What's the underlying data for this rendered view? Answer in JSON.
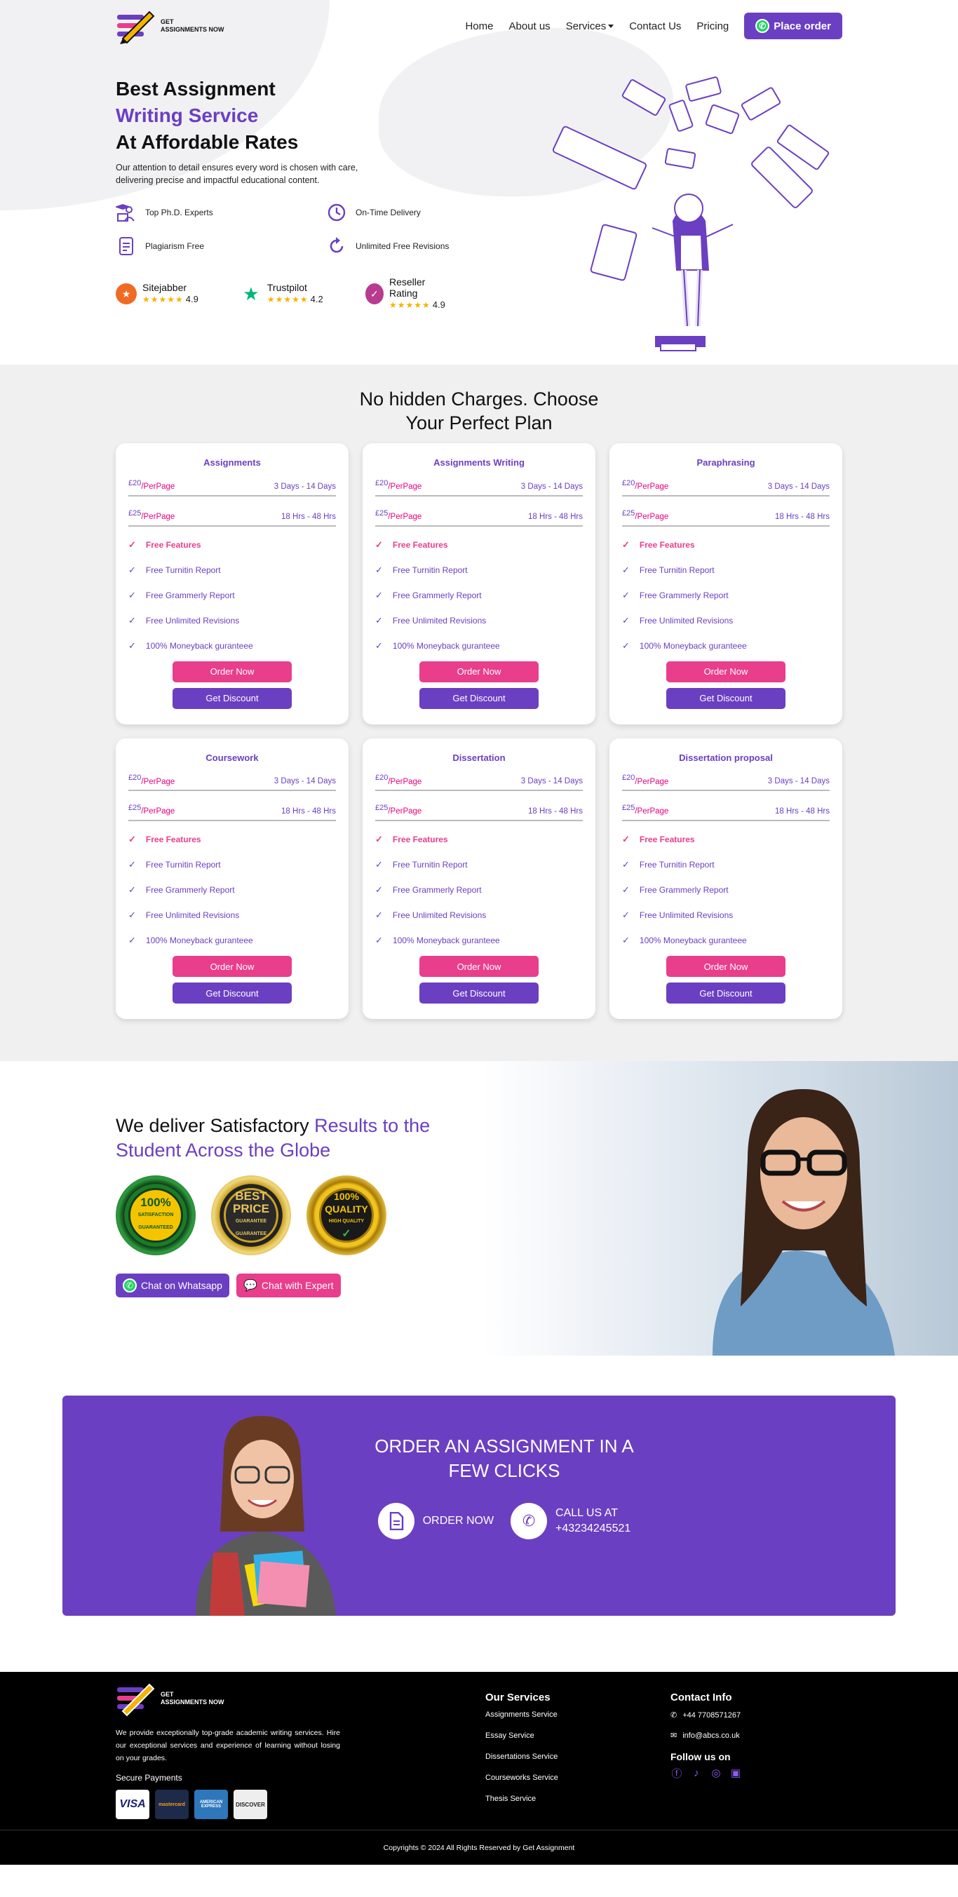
{
  "brand": {
    "line1": "GET",
    "line2": "ASSIGNMENTS NOW"
  },
  "nav": {
    "items": [
      "Home",
      "About us",
      "Services",
      "Contact Us",
      "Pricing"
    ],
    "place_order": "Place order"
  },
  "hero": {
    "title_line1": "Best Assignment",
    "title_line2": "Writing Service",
    "title_line3": "At Affordable Rates",
    "subtitle": "Our attention to detail ensures every word is chosen with care, delivering precise and impactful educational content.",
    "features": [
      {
        "label": "Top Ph.D. Experts",
        "icon": "graduate-icon"
      },
      {
        "label": "On-Time Delivery",
        "icon": "clock-icon"
      },
      {
        "label": "Plagiarism Free",
        "icon": "document-icon"
      },
      {
        "label": "Unlimited Free Revisions",
        "icon": "refresh-icon"
      }
    ],
    "ratings": [
      {
        "name": "Sitejabber",
        "stars": "★★★★★",
        "score": "4.9",
        "color": "#f06a24"
      },
      {
        "name": "Trustpilot",
        "stars": "★★★★★",
        "score": "4.2",
        "color": "#00b67a"
      },
      {
        "name": "Reseller Rating",
        "stars": "★★★★★",
        "score": "4.9",
        "color": "#b83b8f"
      }
    ]
  },
  "pricing": {
    "title_line1": "No hidden Charges. Choose",
    "title_line2": "Your Perfect Plan",
    "order_label": "Order Now",
    "discount_label": "Get Discount",
    "features_head": "Free Features",
    "features": [
      "Free Turnitin Report",
      "Free Grammerly Report",
      "Free Unlimited Revisions",
      "100% Moneyback guranteee"
    ],
    "plans": [
      {
        "title": "Assignments",
        "rows": [
          {
            "amount": "£20",
            "per": "/PerPage",
            "time": "3 Days - 14 Days"
          },
          {
            "amount": "£25",
            "per": "/PerPage",
            "time": "18 Hrs - 48 Hrs"
          }
        ]
      },
      {
        "title": "Assignments Writing",
        "rows": [
          {
            "amount": "£20",
            "per": "/PerPage",
            "time": "3 Days - 14 Days"
          },
          {
            "amount": "£25",
            "per": "/PerPage",
            "time": "18 Hrs - 48 Hrs"
          }
        ]
      },
      {
        "title": "Paraphrasing",
        "rows": [
          {
            "amount": "£20",
            "per": "/PerPage",
            "time": "3 Days - 14 Days"
          },
          {
            "amount": "£25",
            "per": "/PerPage",
            "time": "18 Hrs - 48 Hrs"
          }
        ]
      },
      {
        "title": "Coursework",
        "rows": [
          {
            "amount": "£20",
            "per": "/PerPage",
            "time": "3 Days - 14 Days"
          },
          {
            "amount": "£25",
            "per": "/PerPage",
            "time": "18 Hrs - 48 Hrs"
          }
        ]
      },
      {
        "title": "Dissertation",
        "rows": [
          {
            "amount": "£20",
            "per": "/PerPage",
            "time": "3 Days - 14 Days"
          },
          {
            "amount": "£25",
            "per": "/PerPage",
            "time": "18 Hrs - 48 Hrs"
          }
        ]
      },
      {
        "title": "Dissertation proposal",
        "rows": [
          {
            "amount": "£20",
            "per": "/PerPage",
            "time": "3 Days - 14 Days"
          },
          {
            "amount": "£25",
            "per": "/PerPage",
            "time": "18 Hrs - 48 Hrs"
          }
        ]
      }
    ]
  },
  "satisfy": {
    "title_plain": "We deliver Satisfactory ",
    "title_purple": "Results to the Student Across the Globe",
    "badges": [
      {
        "top": "SATISFACTION",
        "main": "100%",
        "bottom": "GUARANTEED"
      },
      {
        "top": "GUARANTEE",
        "main": "BEST PRICE",
        "bottom": "GUARANTEE"
      },
      {
        "top": "HIGH QUALITY",
        "main": "100% QUALITY",
        "bottom": ""
      }
    ],
    "whatsapp_label": "Chat on Whatsapp",
    "expert_label": "Chat with Expert"
  },
  "cta": {
    "title_line1": "ORDER AN ASSIGNMENT IN A",
    "title_line2": "FEW CLICKS",
    "order_label": "ORDER NOW",
    "call_line1": "CALL US AT",
    "call_line2": "+43234245521"
  },
  "footer": {
    "description": "We provide exceptionally top-grade academic writing services. Hire our exceptional services and experience of learning without losing on your grades.",
    "secure_payments": "Secure Payments",
    "payment_cards": [
      "VISA",
      "mastercard",
      "AMERICAN EXPRESS",
      "DISCOVER"
    ],
    "services_head": "Our Services",
    "services": [
      "Assignments Service",
      "Essay Service",
      "Dissertations Service",
      "Courseworks Service",
      "Thesis Service"
    ],
    "contact_head": "Contact Info",
    "phone": "+44 7708571267",
    "email": "info@abcs.co.uk",
    "follow_head": "Follow us on",
    "copyright": "Copyrights © 2024 All Rights Reserved by Get Assignment"
  },
  "colors": {
    "accent": "#6b3fc1",
    "pink": "#e83e8c",
    "whatsapp": "#25d366"
  }
}
